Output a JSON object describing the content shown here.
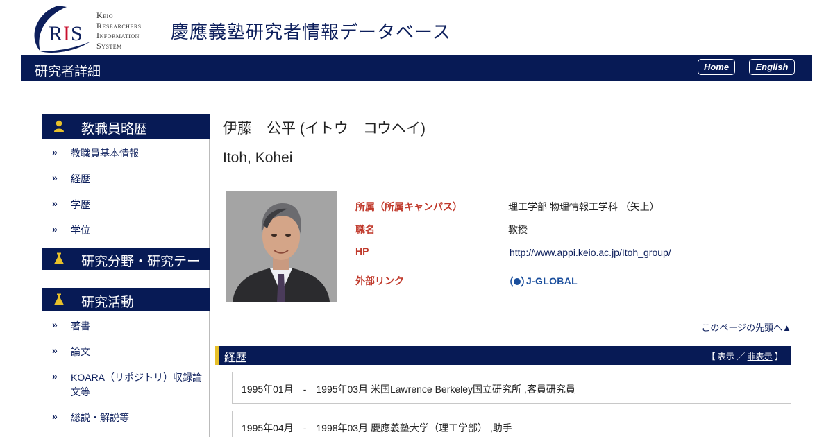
{
  "header": {
    "logo_abbr": "RIS",
    "logo_lines": [
      "Keio",
      "Researchers",
      "Information",
      "System"
    ],
    "site_title": "慶應義塾研究者情報データベース"
  },
  "topbar": {
    "page_title": "研究者詳細",
    "home_label": "Home",
    "english_label": "English"
  },
  "sidebar": {
    "sections": [
      {
        "title": "教職員略歴",
        "icon": "person-icon",
        "items": [
          "教職員基本情報",
          "経歴",
          "学歴",
          "学位"
        ]
      },
      {
        "title": "研究分野・研究テーマ",
        "icon": "flask-icon",
        "items": []
      },
      {
        "title": "研究活動",
        "icon": "flask-icon",
        "items": [
          "著書",
          "論文",
          "KOARA（リポジトリ）収録論文等",
          "総説・解説等"
        ]
      }
    ],
    "chevron": "»"
  },
  "profile": {
    "name_ja": "伊藤　公平 (イトウ　コウヘイ)",
    "name_en": "Itoh, Kohei",
    "photo_alt": "researcher-portrait",
    "fields": {
      "affiliation_label": "所属（所属キャンパス）",
      "affiliation_value": "理工学部 物理情報工学科 （矢上）",
      "position_label": "職名",
      "position_value": "教授",
      "hp_label": "HP",
      "hp_value": "http://www.appi.keio.ac.jp/Itoh_group/",
      "external_label": "外部リンク",
      "external_value": "J-GLOBAL"
    }
  },
  "page_top_link": "このページの先頭へ▲",
  "career_section": {
    "title": "経歴",
    "toggle_open": "【",
    "toggle_show": "表示",
    "toggle_sep": "／",
    "toggle_hide": "非表示",
    "toggle_close": "】",
    "rows": [
      "1995年01月　-　1995年03月 米国Lawrence Berkeley国立研究所 ,客員研究員",
      "1995年04月　-　1998年03月 慶應義塾大学（理工学部） ,助手"
    ]
  },
  "colors": {
    "navy": "#071a55",
    "accent_red": "#c0392b",
    "accent_gold": "#e7c02a"
  }
}
